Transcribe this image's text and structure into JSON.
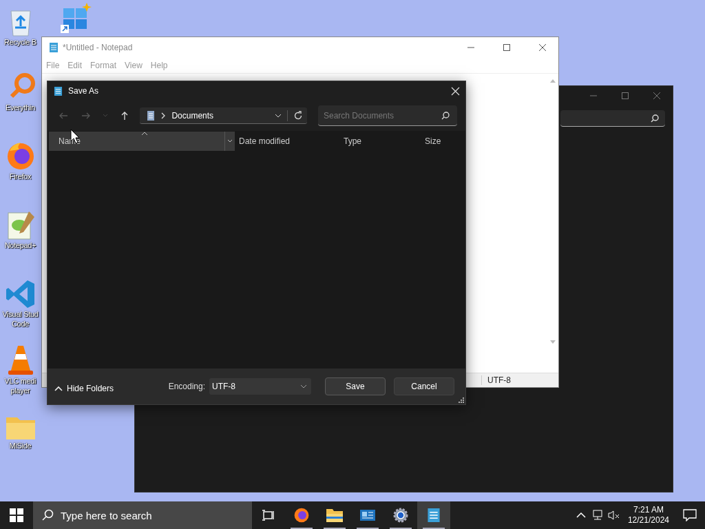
{
  "desktop_icons": [
    {
      "kind": "recycle",
      "lines": [
        "Recycle B"
      ]
    },
    {
      "kind": "tiles"
    },
    {
      "kind": "search",
      "lines": [
        "Everythin"
      ]
    },
    {
      "kind": "firefox",
      "lines": [
        "Firefox"
      ]
    },
    {
      "kind": "notepadpp",
      "lines": [
        "Notepad+"
      ]
    },
    {
      "kind": "vscode",
      "lines": [
        "Visual Stud",
        "Code"
      ]
    },
    {
      "kind": "vlc",
      "lines": [
        "VLC medi",
        "player"
      ]
    },
    {
      "kind": "folder",
      "lines": [
        "MiSide"
      ]
    }
  ],
  "notepad": {
    "title": "*Untitled - Notepad",
    "menu": [
      "File",
      "Edit",
      "Format",
      "View",
      "Help"
    ],
    "status_bar": {
      "encoding": "UTF-8"
    }
  },
  "save_dialog": {
    "title": "Save As",
    "folder": "Documents",
    "search": {
      "placeholder": "Search Documents"
    },
    "columns": [
      {
        "label": "Name",
        "highlighted": true
      },
      {
        "label": "Date modified",
        "highlighted": false
      },
      {
        "label": "Type",
        "highlighted": false
      },
      {
        "label": "Size",
        "highlighted": false
      }
    ],
    "hide_folders": "Hide Folders",
    "encoding": {
      "label": "Encoding:",
      "value": "UTF-8"
    },
    "buttons": [
      "Save",
      "Cancel"
    ]
  },
  "taskbar": {
    "search": {
      "placeholder": "Type here to search"
    },
    "apps": [
      {
        "kind": "taskview",
        "running": false,
        "selected": false
      },
      {
        "kind": "firefox",
        "running": true,
        "selected": false
      },
      {
        "kind": "explorer",
        "running": true,
        "selected": false
      },
      {
        "kind": "card",
        "running": true,
        "selected": false
      },
      {
        "kind": "gear",
        "running": true,
        "selected": false
      },
      {
        "kind": "notepad",
        "running": true,
        "selected": true
      }
    ],
    "time": "7:21 AM",
    "date": "12/21/2024"
  }
}
